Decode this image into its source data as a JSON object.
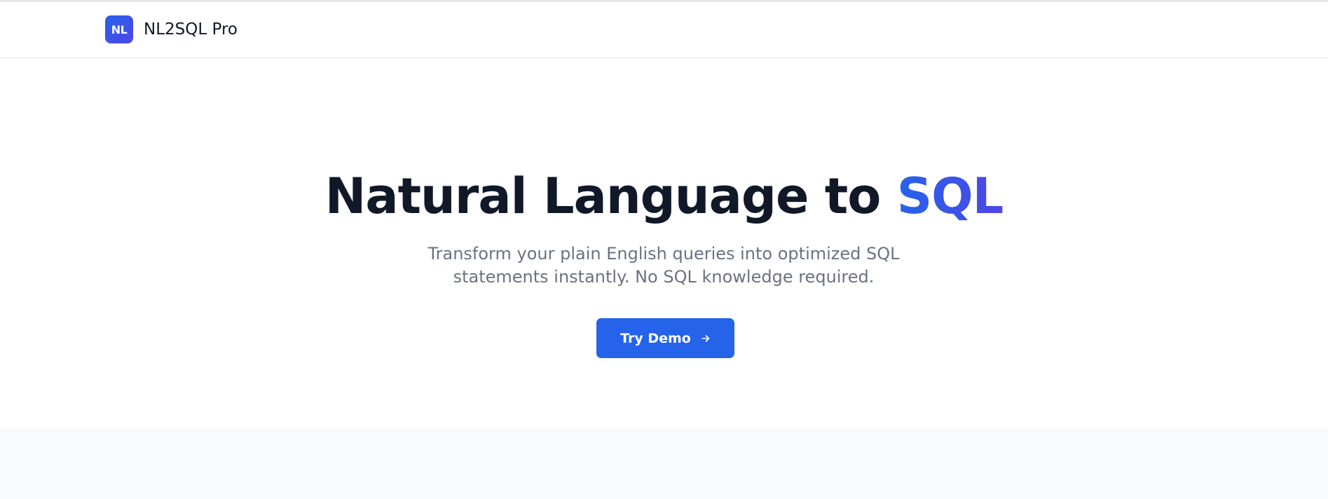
{
  "header": {
    "logo_text": "NL",
    "brand_name": "NL2SQL Pro"
  },
  "hero": {
    "title_main": "Natural Language to ",
    "title_accent": "SQL",
    "subtitle_line1": "Transform your plain English queries into optimized SQL",
    "subtitle_line2": "statements instantly. No SQL knowledge required.",
    "cta_label": "Try Demo",
    "cta_icon": "arrow-right-icon"
  },
  "colors": {
    "primary": "#2563eb",
    "accent_gradient_end": "#4f46e5",
    "heading": "#111827",
    "muted": "#6b7280",
    "border": "#e5e7eb",
    "section_bg": "#f9fafb"
  }
}
